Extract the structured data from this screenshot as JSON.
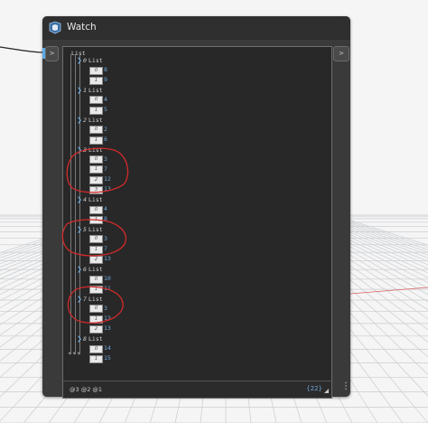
{
  "node": {
    "title": "Watch",
    "in_port_label": ">",
    "out_port_label": ">",
    "root_label": "List",
    "levels_label": "@3 @2 @1",
    "count_label": "{22}"
  },
  "colors": {
    "node_bg": "#3a3a3a",
    "panel_bg": "#282828",
    "value_blue": "#6ea8d9",
    "annotation_red": "#d42a2a"
  },
  "tree": [
    {
      "index": "0",
      "label": "List",
      "items": [
        {
          "i": "0",
          "v": "8"
        },
        {
          "i": "1",
          "v": "9"
        }
      ]
    },
    {
      "index": "1",
      "label": "List",
      "items": [
        {
          "i": "0",
          "v": "4"
        },
        {
          "i": "1",
          "v": "5"
        }
      ]
    },
    {
      "index": "2",
      "label": "List",
      "items": [
        {
          "i": "0",
          "v": "2"
        },
        {
          "i": "1",
          "v": "6"
        }
      ]
    },
    {
      "index": "3",
      "label": "List",
      "items": [
        {
          "i": "0",
          "v": "3"
        },
        {
          "i": "1",
          "v": "7"
        },
        {
          "i": "2",
          "v": "12"
        },
        {
          "i": "3",
          "v": "13"
        }
      ]
    },
    {
      "index": "4",
      "label": "List",
      "items": [
        {
          "i": "0",
          "v": "4"
        },
        {
          "i": "1",
          "v": "8"
        }
      ]
    },
    {
      "index": "5",
      "label": "List",
      "items": [
        {
          "i": "0",
          "v": "3"
        },
        {
          "i": "1",
          "v": "7"
        },
        {
          "i": "2",
          "v": "13"
        }
      ]
    },
    {
      "index": "6",
      "label": "List",
      "items": [
        {
          "i": "0",
          "v": "10"
        },
        {
          "i": "1",
          "v": "11"
        }
      ]
    },
    {
      "index": "7",
      "label": "List",
      "items": [
        {
          "i": "0",
          "v": "3"
        },
        {
          "i": "1",
          "v": "12"
        },
        {
          "i": "2",
          "v": "13"
        }
      ]
    },
    {
      "index": "8",
      "label": "List",
      "items": [
        {
          "i": "0",
          "v": "14"
        },
        {
          "i": "1",
          "v": "15"
        }
      ]
    }
  ]
}
